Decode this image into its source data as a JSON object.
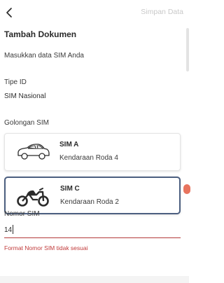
{
  "header": {
    "back_icon": "chevron-left-icon",
    "save_label": "Simpan Data"
  },
  "page": {
    "title": "Tambah Dokumen",
    "subtitle": "Masukkan data SIM Anda"
  },
  "tipe_id": {
    "label": "Tipe ID",
    "value": "SIM Nasional"
  },
  "golongan": {
    "label": "Golongan SIM",
    "options": [
      {
        "title": "SIM A",
        "description": "Kendaraan Roda 4",
        "icon": "car-icon",
        "selected": false
      },
      {
        "title": "SIM C",
        "description": "Kendaraan Roda 2",
        "icon": "motorcycle-icon",
        "selected": true
      }
    ]
  },
  "nomor_sim": {
    "label": "Nomor SIM",
    "value": "14",
    "error": "Format Nomor SIM tidak sesuai"
  },
  "colors": {
    "selected_border": "#4c5f80",
    "error": "#c03a3a",
    "disabled_text": "#c9c9c9"
  }
}
